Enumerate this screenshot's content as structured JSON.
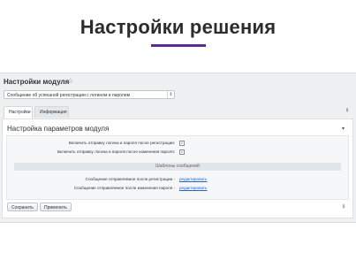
{
  "hero": {
    "title": "Настройки решения"
  },
  "panel": {
    "title": "Настройки модуля"
  },
  "select": {
    "value": "Сообщение об успешной регистрации с логином и паролем"
  },
  "tabs": [
    {
      "label": "Настройки"
    },
    {
      "label": "Информация"
    }
  ],
  "section": {
    "title": "Настройка параметров модуля"
  },
  "options": [
    {
      "label": "Включить отправку логина и пароля после регистрации:",
      "checked": true
    },
    {
      "label": "Включить отправку логина и пароля после изменения пароля:",
      "checked": true
    }
  ],
  "templates": {
    "header": "Шаблоны сообщений",
    "rows": [
      {
        "label": "Сообщение отправляемое после регистрации -",
        "link": "редактировать"
      },
      {
        "label": "Сообщение отправляемое после изменения пароля -",
        "link": "редактировать"
      }
    ]
  },
  "buttons": {
    "save": "Сохранить",
    "apply": "Применить"
  },
  "icons": {
    "star": "star-icon",
    "pin": "pin-icon",
    "collapse": "chevron-down-icon",
    "select_arrow": "chevron-updown-icon"
  },
  "colors": {
    "accent": "#5a2a9a",
    "link": "#2266cc"
  }
}
